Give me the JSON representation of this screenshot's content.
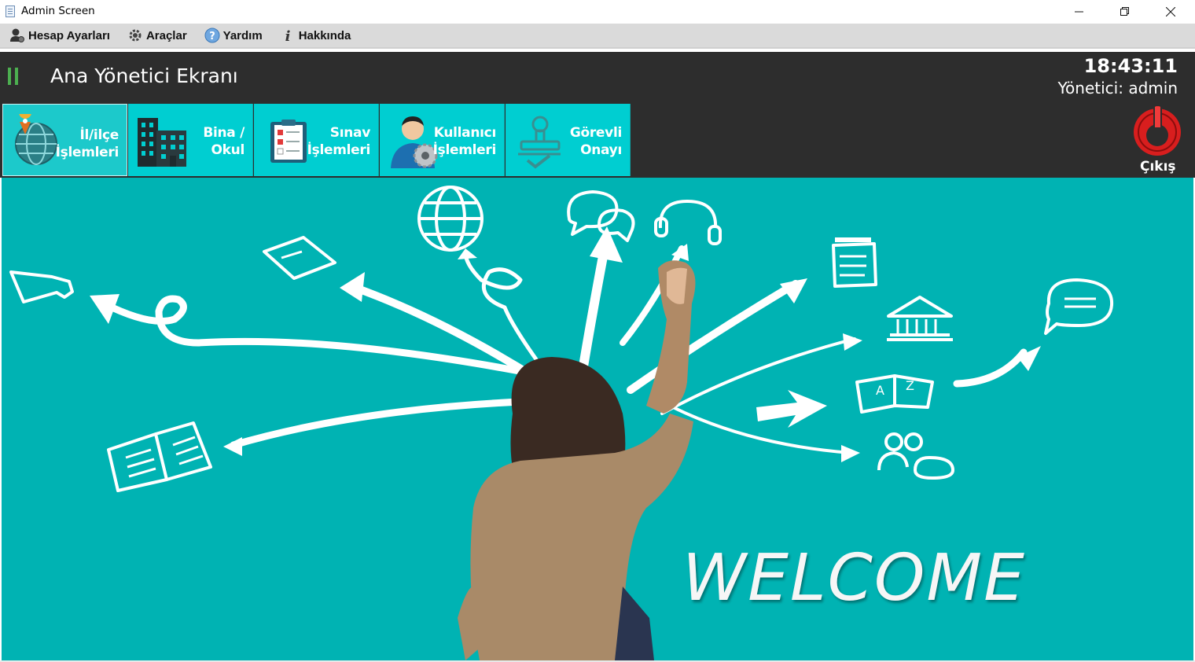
{
  "window": {
    "title": "Admin Screen"
  },
  "menu": {
    "items": [
      {
        "label": "Hesap Ayarları",
        "icon": "user-gear-icon"
      },
      {
        "label": "Araçlar",
        "icon": "gear-icon"
      },
      {
        "label": "Yardım",
        "icon": "help-icon"
      },
      {
        "label": "Hakkında",
        "icon": "info-icon"
      }
    ]
  },
  "header": {
    "title": "Ana Yönetici Ekranı",
    "clock": "18:43:11",
    "user": "Yönetici: admin"
  },
  "toolbar": {
    "tiles": [
      {
        "line1": "İl/ilçe",
        "line2": "İşlemleri",
        "icon": "globe-location-icon"
      },
      {
        "line1": "Bina /",
        "line2": "Okul",
        "icon": "building-icon"
      },
      {
        "line1": "Sınav",
        "line2": "İşlemleri",
        "icon": "exam-clipboard-icon"
      },
      {
        "line1": "Kullanıcı",
        "line2": "İşlemleri",
        "icon": "user-settings-icon"
      },
      {
        "line1": "Görevli",
        "line2": "Onayı",
        "icon": "stamp-approval-icon"
      }
    ],
    "logout_label": "Çıkış"
  },
  "banner": {
    "welcome": "WELCOME",
    "letters_left": "A",
    "letters_right": "Z"
  },
  "colors": {
    "accent": "#00ced1",
    "banner_bg": "#00b3b3",
    "header_bg": "#2d2d2d",
    "logout_red": "#e02020"
  }
}
